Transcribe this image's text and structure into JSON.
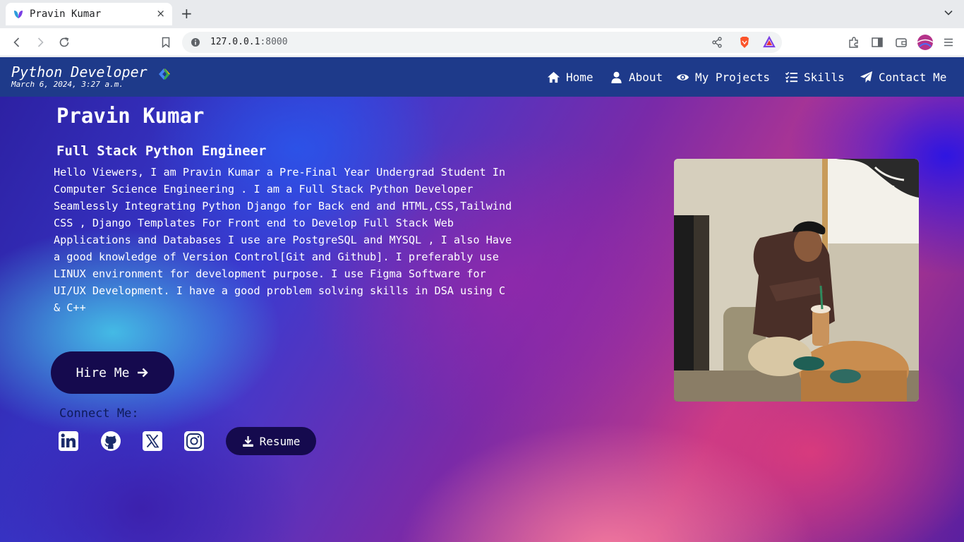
{
  "browser": {
    "tab_title": "Pravin Kumar",
    "close_glyph": "×",
    "new_tab_glyph": "+",
    "url_host": "127.0.0.1",
    "url_port": ":8000"
  },
  "navbar": {
    "brand": "Python Developer",
    "datetime": "March 6, 2024, 3:27 a.m.",
    "items": [
      {
        "label": "Home",
        "icon": "home-icon"
      },
      {
        "label": "About",
        "icon": "user-icon"
      },
      {
        "label": "My Projects",
        "icon": "eye-icon"
      },
      {
        "label": "Skills",
        "icon": "list-check-icon"
      },
      {
        "label": "Contact Me",
        "icon": "paper-plane-icon"
      }
    ]
  },
  "hero": {
    "name": "Pravin Kumar",
    "title": "Full Stack Python Engineer",
    "bio": "Hello Viewers, I am Pravin Kumar a Pre-Final Year Undergrad Student In Computer Science Engineering . I am a Full Stack Python Developer Seamlessly Integrating Python Django for Back end and HTML,CSS,Tailwind CSS , Django Templates For Front end to Develop Full Stack Web Applications and Databases I use are PostgreSQL and MYSQL , I also Have a good knowledge of Version Control[Git and Github]. I preferably use LINUX environment for development purpose. I use Figma Software for UI/UX Development. I have a good problem solving skills in DSA using C & C++",
    "hire_label": "Hire Me",
    "connect_label": "Connect Me:",
    "resume_label": "Resume"
  },
  "colors": {
    "navbar": "#1e3a8a",
    "button": "#150a4e",
    "connect_text": "#0f1a5a"
  }
}
